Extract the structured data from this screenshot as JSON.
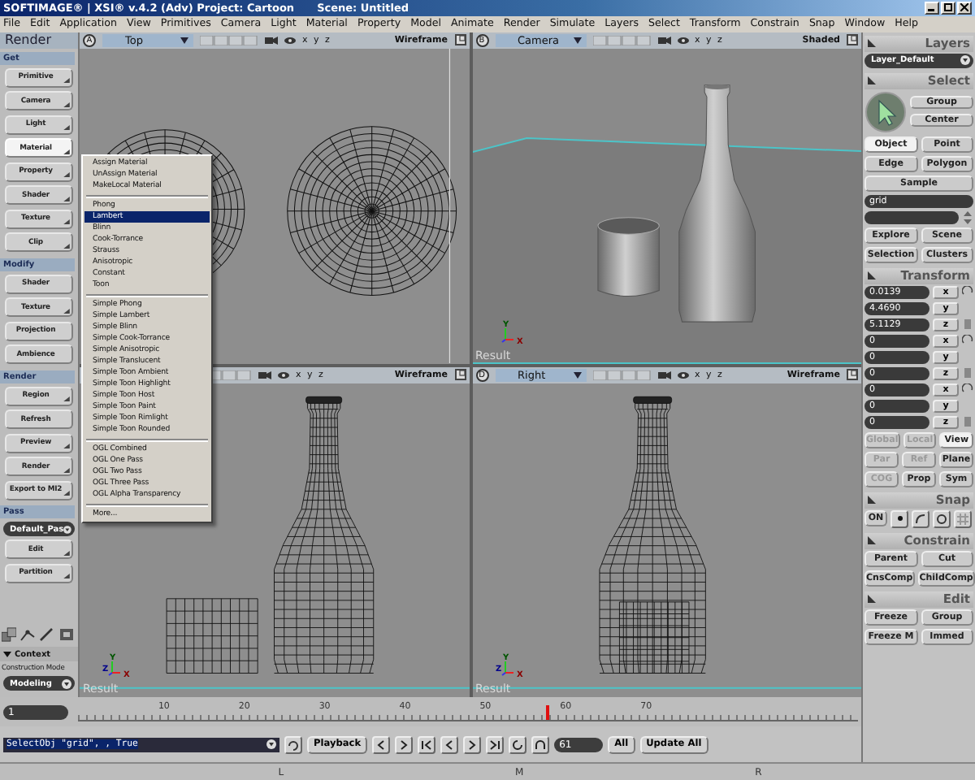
{
  "window": {
    "title": "SOFTIMAGE® | XSI® v.4.2 (Adv) Project: Cartoon",
    "scene": "Scene: Untitled"
  },
  "menu_bar": [
    "File",
    "Edit",
    "Application",
    "View",
    "Primitives",
    "Camera",
    "Light",
    "Material",
    "Property",
    "Model",
    "Animate",
    "Render",
    "Simulate",
    "Layers",
    "Select",
    "Transform",
    "Constrain",
    "Snap",
    "Window",
    "Help"
  ],
  "left_panel": {
    "title": "Render",
    "sections": [
      {
        "title": "Get",
        "items": [
          {
            "kind": "button",
            "label": "Primitive",
            "caret": true,
            "pressed": false
          },
          {
            "kind": "button",
            "label": "Camera",
            "caret": true,
            "pressed": false
          },
          {
            "kind": "button",
            "label": "Light",
            "caret": true,
            "pressed": false
          },
          {
            "kind": "button",
            "label": "Material",
            "caret": true,
            "pressed": true
          },
          {
            "kind": "button",
            "label": "Property",
            "caret": true,
            "pressed": false
          },
          {
            "kind": "button",
            "label": "Shader",
            "caret": true,
            "pressed": false
          },
          {
            "kind": "button",
            "label": "Texture",
            "caret": true,
            "pressed": false
          },
          {
            "kind": "button",
            "label": "Clip",
            "caret": true,
            "pressed": false
          }
        ]
      },
      {
        "title": "Modify",
        "items": [
          {
            "kind": "button",
            "label": "Shader",
            "caret": false,
            "pressed": false
          },
          {
            "kind": "button",
            "label": "Texture",
            "caret": true,
            "pressed": false
          },
          {
            "kind": "button",
            "label": "Projection",
            "caret": false,
            "pressed": false
          },
          {
            "kind": "button",
            "label": "Ambience",
            "caret": false,
            "pressed": false
          }
        ]
      },
      {
        "title": "Render",
        "items": [
          {
            "kind": "button",
            "label": "Region",
            "caret": true,
            "pressed": false
          },
          {
            "kind": "button",
            "label": "Refresh",
            "caret": false,
            "pressed": false
          },
          {
            "kind": "button",
            "label": "Preview",
            "caret": true,
            "pressed": false
          },
          {
            "kind": "button",
            "label": "Render",
            "caret": true,
            "pressed": false
          },
          {
            "kind": "button",
            "label": "Export to MI2",
            "caret": true,
            "pressed": false
          }
        ]
      },
      {
        "title": "Pass",
        "items": [
          {
            "kind": "dropdown",
            "value": "Default_Pas"
          },
          {
            "kind": "button",
            "label": "Edit",
            "caret": true,
            "pressed": false
          },
          {
            "kind": "button",
            "label": "Partition",
            "caret": true,
            "pressed": false
          }
        ]
      }
    ],
    "context": {
      "title": "Context",
      "expanded": true,
      "label": "Construction Mode",
      "value": "Modeling"
    }
  },
  "popup_menu": {
    "groups": [
      [
        {
          "label": "Assign Material",
          "selected": false
        },
        {
          "label": "UnAssign Material",
          "selected": false
        },
        {
          "label": "MakeLocal Material",
          "selected": false
        }
      ],
      [
        {
          "label": "Phong",
          "selected": false
        },
        {
          "label": "Lambert",
          "selected": true
        },
        {
          "label": "Blinn",
          "selected": false
        },
        {
          "label": "Cook-Torrance",
          "selected": false
        },
        {
          "label": "Strauss",
          "selected": false
        },
        {
          "label": "Anisotropic",
          "selected": false
        },
        {
          "label": "Constant",
          "selected": false
        },
        {
          "label": "Toon",
          "selected": false
        }
      ],
      [
        {
          "label": "Simple Phong",
          "selected": false
        },
        {
          "label": "Simple Lambert",
          "selected": false
        },
        {
          "label": "Simple Blinn",
          "selected": false
        },
        {
          "label": "Simple Cook-Torrance",
          "selected": false
        },
        {
          "label": "Simple Anisotropic",
          "selected": false
        },
        {
          "label": "Simple Translucent",
          "selected": false
        },
        {
          "label": "Simple Toon Ambient",
          "selected": false
        },
        {
          "label": "Simple Toon Highlight",
          "selected": false
        },
        {
          "label": "Simple Toon Host",
          "selected": false
        },
        {
          "label": "Simple Toon Paint",
          "selected": false
        },
        {
          "label": "Simple Toon Rimlight",
          "selected": false
        },
        {
          "label": "Simple Toon Rounded",
          "selected": false
        }
      ],
      [
        {
          "label": "OGL Combined",
          "selected": false
        },
        {
          "label": "OGL One Pass",
          "selected": false
        },
        {
          "label": "OGL Two Pass",
          "selected": false
        },
        {
          "label": "OGL Three Pass",
          "selected": false
        },
        {
          "label": "OGL Alpha Transparency",
          "selected": false
        }
      ],
      [
        {
          "label": "More...",
          "selected": false
        }
      ]
    ]
  },
  "viewports": [
    {
      "kind": "top",
      "letter": "A",
      "view": "Top",
      "axes": "x y z",
      "mode": "Wireframe"
    },
    {
      "kind": "camera",
      "letter": "B",
      "view": "Camera",
      "axes": "x y z",
      "mode": "Shaded",
      "result": "Result",
      "gizmo": [
        "Y",
        "X"
      ]
    },
    {
      "kind": "front",
      "axes": "x y z",
      "mode": "Wireframe",
      "result": "Result",
      "gizmo": [
        "Y",
        "Z",
        "X"
      ]
    },
    {
      "kind": "right",
      "letter": "D",
      "view": "Right",
      "axes": "x y z",
      "mode": "Wireframe",
      "result": "Result",
      "gizmo": [
        "Y",
        "Z",
        "X"
      ]
    }
  ],
  "right_panel": {
    "sections": [
      {
        "title": "Layers",
        "rows": [
          {
            "kind": "dropdown",
            "value": "Layer_Default"
          }
        ]
      },
      {
        "title": "Select",
        "rows": [
          {
            "kind": "tool",
            "buttons": [
              {
                "label": "Group"
              },
              {
                "label": "Center"
              }
            ]
          },
          {
            "kind": "buttons",
            "buttons": [
              {
                "label": "Object",
                "selected": true
              },
              {
                "label": "Point",
                "selected": false
              }
            ]
          },
          {
            "kind": "buttons",
            "buttons": [
              {
                "label": "Edge",
                "selected": false
              },
              {
                "label": "Polygon",
                "selected": false
              }
            ]
          },
          {
            "kind": "buttons",
            "buttons": [
              {
                "label": "Sample"
              }
            ]
          },
          {
            "kind": "field",
            "value": "grid"
          },
          {
            "kind": "blank_field"
          },
          {
            "kind": "buttons",
            "buttons": [
              {
                "label": "Explore"
              },
              {
                "label": "Scene"
              }
            ]
          },
          {
            "kind": "buttons",
            "buttons": [
              {
                "label": "Selection"
              },
              {
                "label": "Clusters"
              }
            ]
          }
        ]
      },
      {
        "title": "Transform",
        "rows": [
          {
            "kind": "transform",
            "value": "0.0139",
            "axis": "x"
          },
          {
            "kind": "transform",
            "value": "4.4690",
            "axis": "y"
          },
          {
            "kind": "transform",
            "value": "5.1129",
            "axis": "z"
          },
          {
            "kind": "transform",
            "value": "0",
            "axis": "x"
          },
          {
            "kind": "transform",
            "value": "0",
            "axis": "y"
          },
          {
            "kind": "transform",
            "value": "0",
            "axis": "z"
          },
          {
            "kind": "transform",
            "value": "0",
            "axis": "x"
          },
          {
            "kind": "transform",
            "value": "0",
            "axis": "y"
          },
          {
            "kind": "transform",
            "value": "0",
            "axis": "z"
          },
          {
            "kind": "buttons",
            "buttons": [
              {
                "label": "Global",
                "selected": false,
                "disabled": true
              },
              {
                "label": "Local",
                "selected": false,
                "disabled": true
              },
              {
                "label": "View",
                "selected": true,
                "disabled": false
              }
            ]
          },
          {
            "kind": "buttons",
            "buttons": [
              {
                "label": "Par",
                "selected": false,
                "disabled": true
              },
              {
                "label": "Ref",
                "selected": false,
                "disabled": true
              },
              {
                "label": "Plane",
                "selected": false,
                "disabled": false
              }
            ]
          },
          {
            "kind": "buttons",
            "buttons": [
              {
                "label": "COG",
                "disabled": true
              },
              {
                "label": "Prop",
                "disabled": false
              },
              {
                "label": "Sym",
                "disabled": false
              }
            ]
          }
        ]
      },
      {
        "title": "Snap",
        "rows": [
          {
            "kind": "snap",
            "label": "ON"
          }
        ]
      },
      {
        "title": "Constrain",
        "rows": [
          {
            "kind": "buttons",
            "buttons": [
              {
                "label": "Parent"
              },
              {
                "label": "Cut"
              }
            ]
          },
          {
            "kind": "buttons",
            "buttons": [
              {
                "label": "CnsComp"
              },
              {
                "label": "ChildComp"
              }
            ]
          }
        ]
      },
      {
        "title": "Edit",
        "rows": [
          {
            "kind": "buttons",
            "buttons": [
              {
                "label": "Freeze"
              },
              {
                "label": "Group"
              }
            ]
          },
          {
            "kind": "buttons",
            "buttons": [
              {
                "label": "Freeze M"
              },
              {
                "label": "Immed"
              }
            ]
          }
        ]
      }
    ]
  },
  "timeline": {
    "start": "1",
    "ticks": [
      "10",
      "20",
      "30",
      "40",
      "50",
      "60",
      "70"
    ],
    "level": 0.6
  },
  "command_bar": {
    "command": "SelectObj \"grid\", , True",
    "playback": "Playback",
    "frame": "61",
    "all": "All",
    "update_all": "Update All"
  },
  "bottom_strip": [
    "L",
    "M",
    "R"
  ]
}
